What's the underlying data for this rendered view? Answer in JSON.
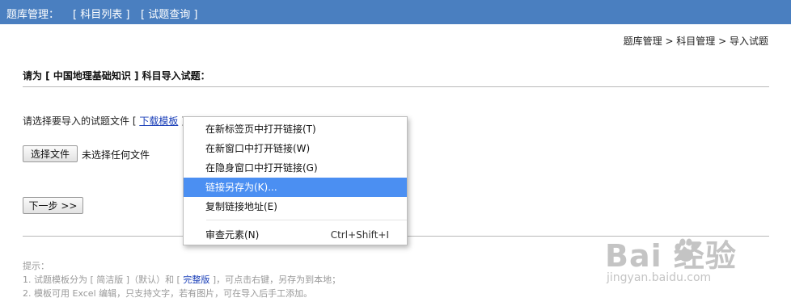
{
  "topbar": {
    "title": "题库管理：",
    "nav": [
      "[ 科目列表 ]",
      "[ 试题查询 ]"
    ]
  },
  "breadcrumb": {
    "text": "题库管理 > 科目管理 > 导入试题"
  },
  "main": {
    "heading": "请为 [ 中国地理基础知识 ] 科目导入试题：",
    "choose_prefix": "请选择要导入的试题文件 [ ",
    "download_link": "下载模板",
    "choose_suffix": " ]",
    "file_button": "选择文件",
    "no_file": "未选择任何文件",
    "next_button": "下一步 >>"
  },
  "tips": {
    "title": "提示：",
    "line1_a": "1. 试题模板分为 [ 简洁版 ]（默认）和 [ ",
    "line1_link": "完整版",
    "line1_b": " ]，可点击右键，另存为到本地；",
    "line2": "2. 模板可用 Excel 编辑，只支持文字，若有图片，可在导入后手工添加。"
  },
  "context_menu": {
    "items": [
      {
        "label": "在新标签页中打开链接(T)"
      },
      {
        "label": "在新窗口中打开链接(W)"
      },
      {
        "label": "在隐身窗口中打开链接(G)"
      },
      {
        "label": "链接另存为(K)..."
      },
      {
        "label": "复制链接地址(E)"
      },
      {
        "label": "审查元素(N)",
        "shortcut": "Ctrl+Shift+I"
      }
    ],
    "highlight_color": "#4b8ff2"
  },
  "watermark": {
    "logo_text": "Bai  经验",
    "url": "jingyan.baidu.com"
  },
  "colors": {
    "topbar": "#4a7fc0",
    "link": "#1a3fb8"
  }
}
